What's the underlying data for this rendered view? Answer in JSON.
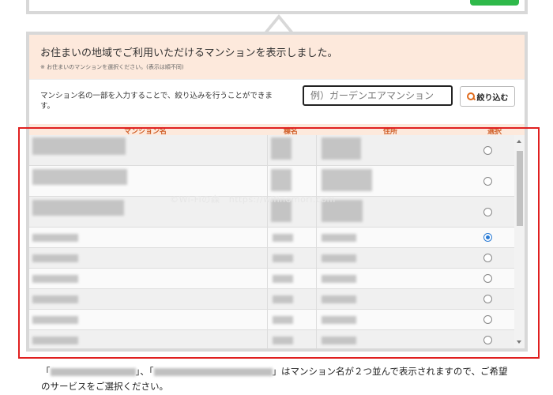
{
  "banner": {
    "title": "お住まいの地域でご利用いただけるマンションを表示しました。",
    "note": "※ お住まいのマンションを選択ください。(表示は順不同)"
  },
  "filter": {
    "description": "マンション名の一部を入力することで、絞り込みを行うことができます。",
    "placeholder": "例）ガーデンエアマンション",
    "button_label": "絞り込む"
  },
  "table": {
    "headers": [
      "マンション名",
      "棟名",
      "住所",
      "選択"
    ],
    "selected_row": 3
  },
  "watermark": "©Wi-Fiの森　https://wifinomori.com",
  "bottom_text": {
    "part1": "「",
    "part2": "」、「",
    "part3": "」はマンション名が２つ並んで表示されますので、ご希望のサービスをご選択ください。"
  }
}
